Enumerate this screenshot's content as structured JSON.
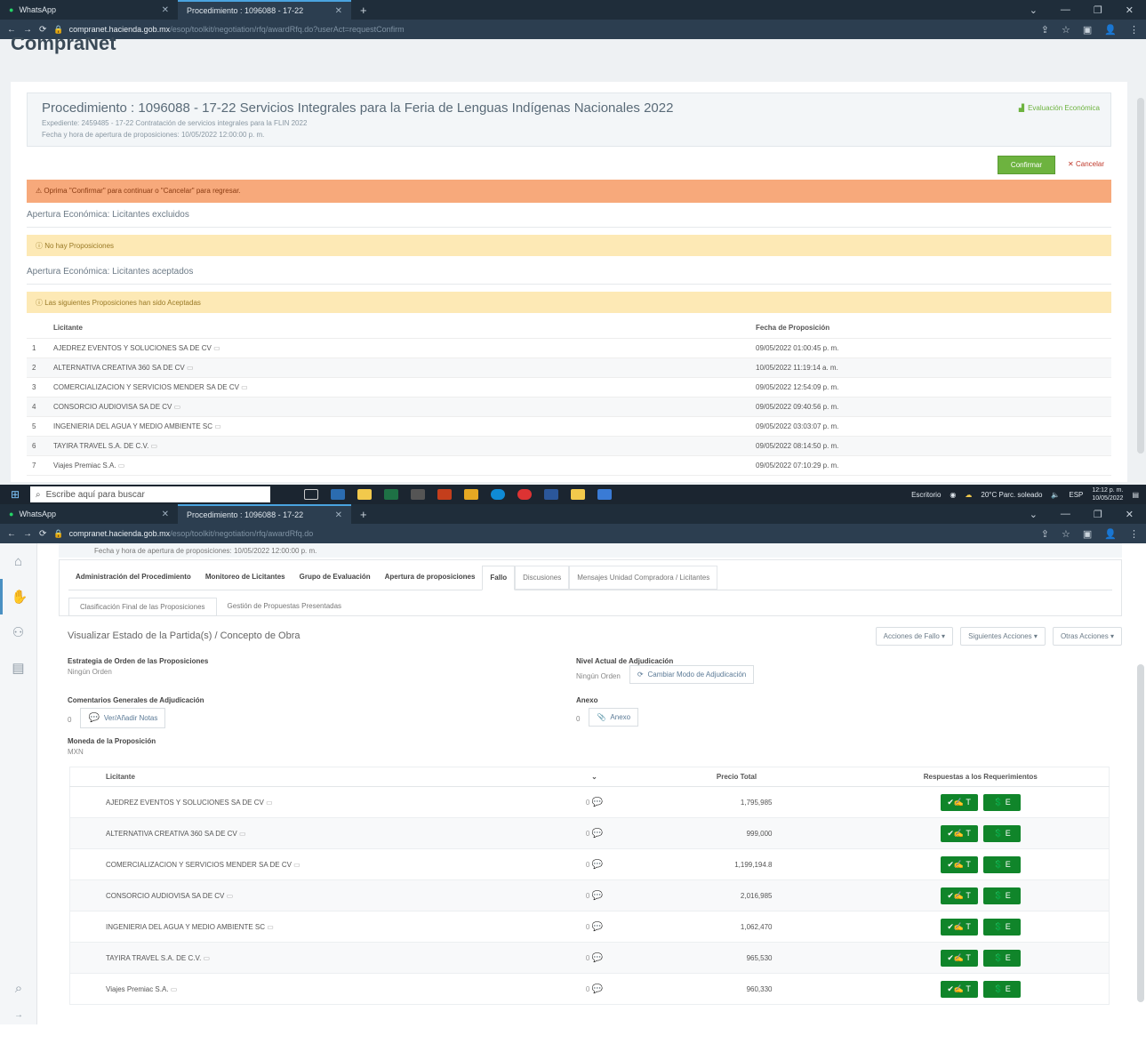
{
  "screen1": {
    "tabs": [
      {
        "label": "WhatsApp",
        "icon": "whatsapp-icon"
      },
      {
        "label": "Procedimiento : 1096088 - 17-22",
        "icon": "compranet-icon"
      }
    ],
    "url": {
      "domain": "compranet.hacienda.gob.mx",
      "path": "/esop/toolkit/negotiation/rfq/awardRfq.do?userAct=requestConfirm"
    },
    "brand": "CompraNet",
    "proc": {
      "title": "Procedimiento : 1096088 - 17-22 Servicios Integrales para la Feria de Lenguas Indígenas Nacionales 2022",
      "expediente": "Expediente: 2459485 - 17-22 Contratación de servicios integrales para la FLIN 2022",
      "fecha": "Fecha y hora de apertura de proposiciones: 10/05/2022 12:00:00 p. m.",
      "evaluacion": "Evaluación Económica"
    },
    "confirm_label": "Confirmar",
    "cancel_label": "Cancelar",
    "alert": "Oprima \"Confirmar\" para continuar o \"Cancelar\" para regresar.",
    "sec_excluidos": "Apertura Económica: Licitantes excluidos",
    "no_props": "No hay Proposiciones",
    "sec_aceptados": "Apertura Económica: Licitantes aceptados",
    "aceptadas": "Las siguientes Proposiciones han sido Aceptadas",
    "col_licitante": "Licitante",
    "col_fecha": "Fecha de Proposición",
    "rows": [
      {
        "n": "1",
        "name": "AJEDREZ EVENTOS Y SOLUCIONES SA DE CV",
        "date": "09/05/2022 01:00:45 p. m."
      },
      {
        "n": "2",
        "name": "ALTERNATIVA CREATIVA 360 SA DE CV",
        "date": "10/05/2022 11:19:14 a. m."
      },
      {
        "n": "3",
        "name": "COMERCIALIZACION Y SERVICIOS MENDER SA DE CV",
        "date": "09/05/2022 12:54:09 p. m."
      },
      {
        "n": "4",
        "name": "CONSORCIO AUDIOVISA SA DE CV",
        "date": "09/05/2022 09:40:56 p. m."
      },
      {
        "n": "5",
        "name": "INGENIERIA DEL AGUA Y MEDIO AMBIENTE SC",
        "date": "09/05/2022 03:03:07 p. m."
      },
      {
        "n": "6",
        "name": "TAYIRA TRAVEL S.A. DE C.V.",
        "date": "09/05/2022 08:14:50 p. m."
      },
      {
        "n": "7",
        "name": "Viajes Premiac S.A.",
        "date": "09/05/2022 07:10:29 p. m."
      }
    ]
  },
  "taskbar": {
    "search_placeholder": "Escribe aquí para buscar",
    "tray_label": "Escritorio",
    "weather": "20°C Parc. soleado",
    "time": "12:12 p. m.",
    "date": "10/05/2022",
    "lang": "ESP"
  },
  "screen2": {
    "url": {
      "domain": "compranet.hacienda.gob.mx",
      "path": "/esop/toolkit/negotiation/rfq/awardRfq.do"
    },
    "fecha_top": "Fecha y hora de apertura de proposiciones: 10/05/2022 12:00:00 p. m.",
    "navtabs": [
      "Administración del Procedimiento",
      "Monitoreo de Licitantes",
      "Grupo de Evaluación",
      "Apertura de proposiciones",
      "Fallo",
      "Discusiones",
      "Mensajes Unidad Compradora / Licitantes"
    ],
    "subtabs": [
      "Clasificación Final de las Proposiciones",
      "Gestión de Propuestas Presentadas"
    ],
    "section_title": "Visualizar Estado de la Partida(s) / Concepto de Obra",
    "actions": [
      "Acciones de Fallo",
      "Siguientes Acciones",
      "Otras Acciones"
    ],
    "estrategia_label": "Estrategia de Orden de las Proposiciones",
    "estrategia_val": "Ningún Orden",
    "nivel_label": "Nivel Actual de Adjudicación",
    "nivel_val": "Ningún Orden",
    "cambiar_label": "Cambiar Modo de Adjudicación",
    "coment_label": "Comentarios Generales de Adjudicación",
    "coment_count": "0",
    "ver_notas": "Ver/Añadir Notas",
    "anexo_label": "Anexo",
    "anexo_count": "0",
    "anexo_btn": "Anexo",
    "moneda_label": "Moneda de la Proposición",
    "moneda_val": "MXN",
    "cols": {
      "licitante": "Licitante",
      "sort": "⌄",
      "precio": "Precio Total",
      "resp": "Respuestas a los Requerimientos"
    },
    "green1": "T",
    "green2": "E",
    "rows": [
      {
        "name": "AJEDREZ EVENTOS Y SOLUCIONES SA DE CV",
        "notes": "0",
        "price": "1,795,985"
      },
      {
        "name": "ALTERNATIVA CREATIVA 360 SA DE CV",
        "notes": "0",
        "price": "999,000"
      },
      {
        "name": "COMERCIALIZACION Y SERVICIOS MENDER SA DE CV",
        "notes": "0",
        "price": "1,199,194.8"
      },
      {
        "name": "CONSORCIO AUDIOVISA SA DE CV",
        "notes": "0",
        "price": "2,016,985"
      },
      {
        "name": "INGENIERIA DEL AGUA Y MEDIO AMBIENTE SC",
        "notes": "0",
        "price": "1,062,470"
      },
      {
        "name": "TAYIRA TRAVEL S.A. DE C.V.",
        "notes": "0",
        "price": "965,530"
      },
      {
        "name": "Viajes Premiac S.A.",
        "notes": "0",
        "price": "960,330"
      }
    ]
  }
}
